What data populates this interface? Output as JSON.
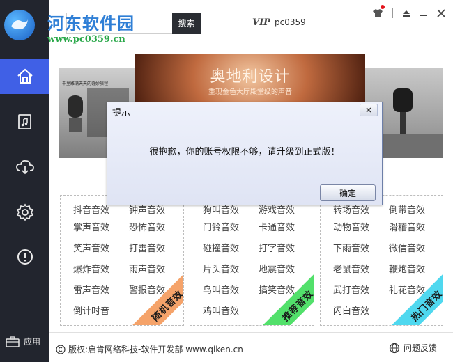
{
  "header": {
    "watermark_title": "河东软件园",
    "watermark_url": "www.pc0359.cn",
    "search_button": "搜索",
    "vip_badge": "VIP",
    "username": "pc0359"
  },
  "sidebar": {
    "items": [
      {
        "icon": "home-icon",
        "active": true
      },
      {
        "icon": "music-file-icon",
        "active": false
      },
      {
        "icon": "cloud-download-icon",
        "active": false
      },
      {
        "icon": "gear-icon",
        "active": false
      },
      {
        "icon": "alert-icon",
        "active": false
      }
    ],
    "apps_label": "应用"
  },
  "banner": {
    "title": "奥地利设计",
    "subtitle": "重现金色大厅殿堂级的声音",
    "left_caption": "千里雕满天天的奇妙旅程"
  },
  "panels": [
    {
      "ribbon": "随机音效",
      "ribbon_color": "#f5a36a",
      "sounds": [
        "抖音音效",
        "钟声音效",
        "掌声音效",
        "恐怖音效",
        "笑声音效",
        "打雷音效",
        "爆炸音效",
        "雨声音效",
        "雷声音效",
        "警报音效",
        "倒计时音"
      ]
    },
    {
      "ribbon": "推荐音效",
      "ribbon_color": "#52e06b",
      "sounds": [
        "狗叫音效",
        "游戏音效",
        "门铃音效",
        "卡通音效",
        "碰撞音效",
        "打字音效",
        "片头音效",
        "地震音效",
        "鸟叫音效",
        "搞笑音效",
        "鸡叫音效"
      ]
    },
    {
      "ribbon": "热门音效",
      "ribbon_color": "#4fd8ef",
      "sounds": [
        "转场音效",
        "倒带音效",
        "动物音效",
        "滑稽音效",
        "下雨音效",
        "微信音效",
        "老鼠音效",
        "鞭炮音效",
        "武打音效",
        "礼花音效",
        "闪白音效"
      ]
    }
  ],
  "footer": {
    "copyright": "版权:启肯网络科技-软件开发部 www.qiken.cn",
    "feedback": "问题反馈"
  },
  "dialog": {
    "title": "提示",
    "message": "很抱歉，你的账号权限不够，请升级到正式版！",
    "ok_button": "确定"
  },
  "colors": {
    "sidebar_bg": "#22252e",
    "active_nav": "#4060e6",
    "notification_dot": "#e3141c"
  }
}
